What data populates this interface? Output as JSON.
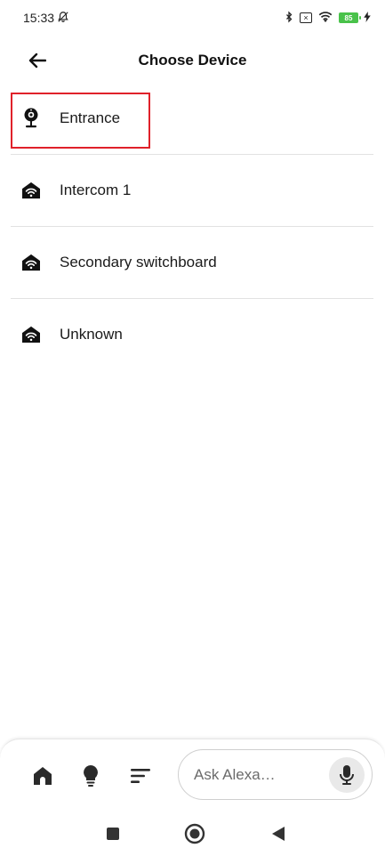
{
  "status_bar": {
    "time": "15:33",
    "battery": "85",
    "icons": [
      "muted-bell-icon",
      "bluetooth-icon",
      "sim-x-icon",
      "wifi-icon",
      "battery-icon",
      "charging-icon"
    ]
  },
  "header": {
    "title": "Choose Device",
    "back_icon": "back-arrow-icon"
  },
  "devices": [
    {
      "label": "Entrance",
      "icon": "camera-icon",
      "highlighted": true
    },
    {
      "label": "Intercom 1",
      "icon": "home-wifi-icon"
    },
    {
      "label": "Secondary switchboard",
      "icon": "home-wifi-icon"
    },
    {
      "label": "Unknown",
      "icon": "home-wifi-icon"
    }
  ],
  "bottom_bar": {
    "nav": [
      "home-icon",
      "bulb-icon",
      "menu-icon"
    ],
    "alexa_placeholder": "Ask Alexa…",
    "mic_icon": "mic-icon"
  },
  "system_nav": [
    "recents-button",
    "home-button",
    "back-button"
  ],
  "colors": {
    "highlight": "#e0212a",
    "divider": "#e2e2e2",
    "icon": "#111111"
  }
}
